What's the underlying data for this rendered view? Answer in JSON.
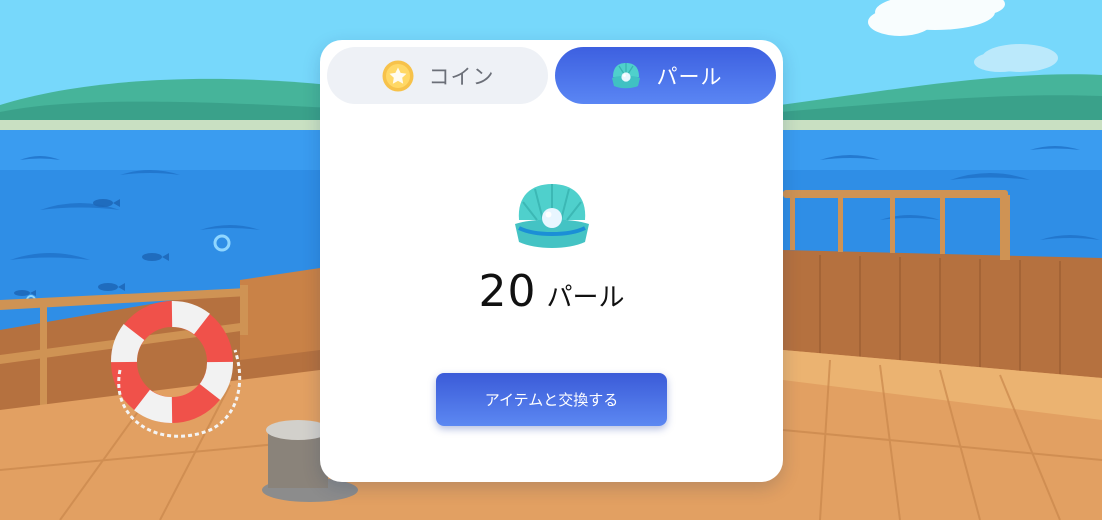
{
  "tabs": {
    "coin": {
      "label": "コイン",
      "icon": "coin-icon",
      "selected": false
    },
    "pearl": {
      "label": "パール",
      "icon": "pearl-icon",
      "selected": true
    }
  },
  "balance": {
    "amount": "20",
    "unit": "パール",
    "icon": "pearl-icon"
  },
  "action": {
    "exchange_label": "アイテムと交換する"
  },
  "colors": {
    "accent": "#4a70ea",
    "tab_inactive": "#eef1f6",
    "sky": "#77d8fb",
    "sea": "#2f8ee6",
    "deck": "#e2a062"
  }
}
